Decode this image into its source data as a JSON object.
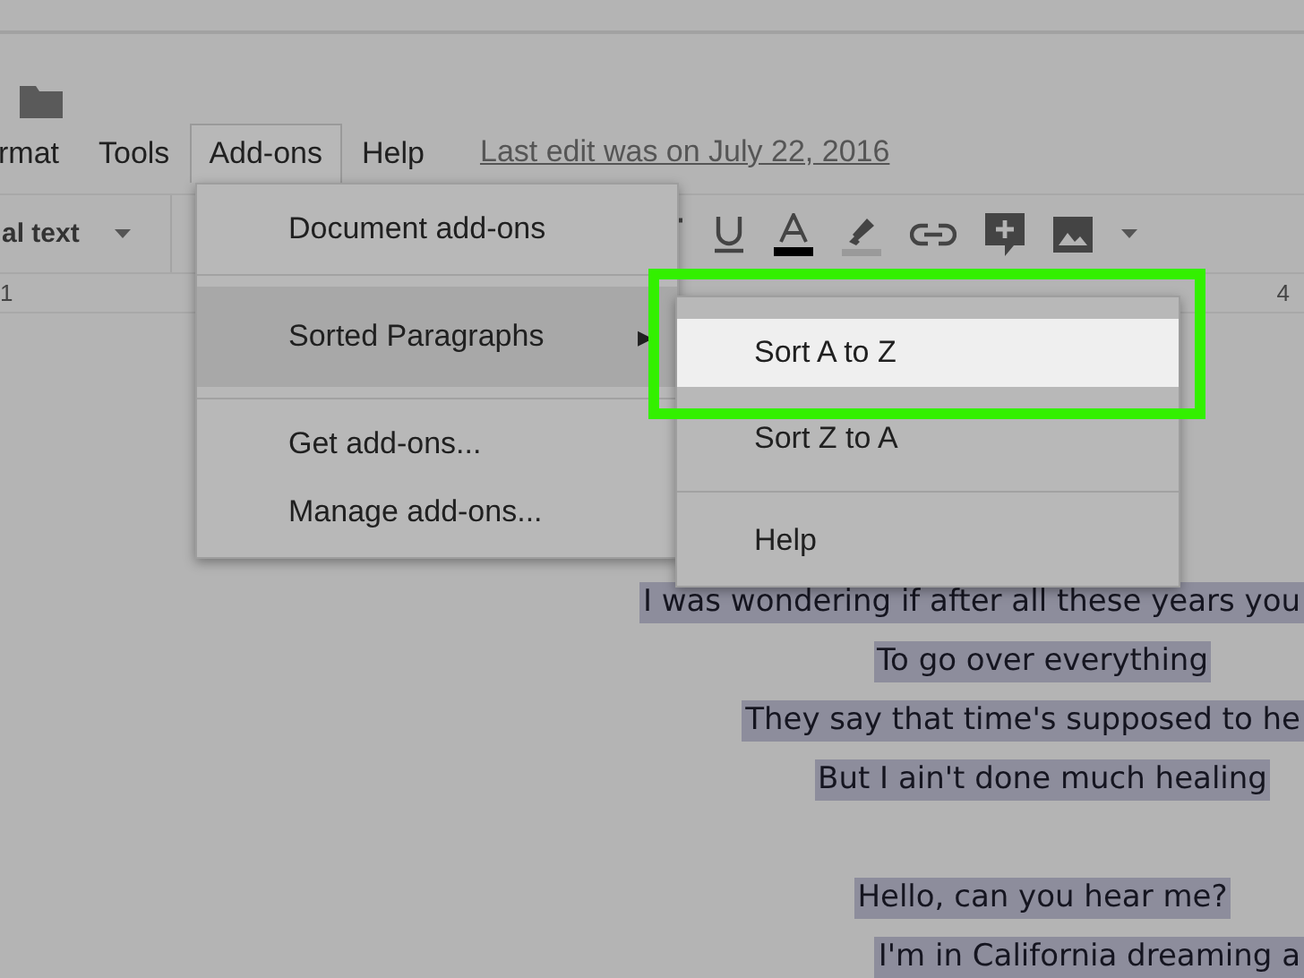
{
  "menubar": {
    "items": [
      {
        "label": "rmat",
        "selected": false
      },
      {
        "label": "Tools",
        "selected": false
      },
      {
        "label": "Add-ons",
        "selected": true
      },
      {
        "label": "Help",
        "selected": false
      }
    ],
    "last_edit": "Last edit was on July 22, 2016"
  },
  "toolbar": {
    "style_dropdown": "al text"
  },
  "ruler": {
    "left_number": "1",
    "right_number": "4"
  },
  "addons_menu": {
    "items": [
      {
        "label": "Document add-ons",
        "kind": "item",
        "selected": false
      },
      {
        "label": "Sorted Paragraphs",
        "kind": "submenu",
        "selected": true
      },
      {
        "label": "Get add-ons...",
        "kind": "item",
        "selected": false
      },
      {
        "label": "Manage add-ons...",
        "kind": "item",
        "selected": false
      }
    ],
    "arrow": "▶"
  },
  "submenu": {
    "items": [
      {
        "label": "Sort A to Z",
        "selected": true
      },
      {
        "label": "Sort Z to A",
        "selected": false
      },
      {
        "label": "Help",
        "selected": false
      }
    ]
  },
  "document": {
    "lines": [
      {
        "text": "I was wondering if after all these years you",
        "kind": "cut"
      },
      {
        "text": "To go over everything",
        "kind": "full"
      },
      {
        "text": "They say that time's supposed to he",
        "kind": "cut"
      },
      {
        "text": "But I ain't done much healing",
        "kind": "full"
      },
      {
        "kind": "blank"
      },
      {
        "text": "Hello, can you hear me?",
        "kind": "full"
      },
      {
        "text": "I'm in California dreaming a",
        "kind": "cut"
      }
    ]
  }
}
